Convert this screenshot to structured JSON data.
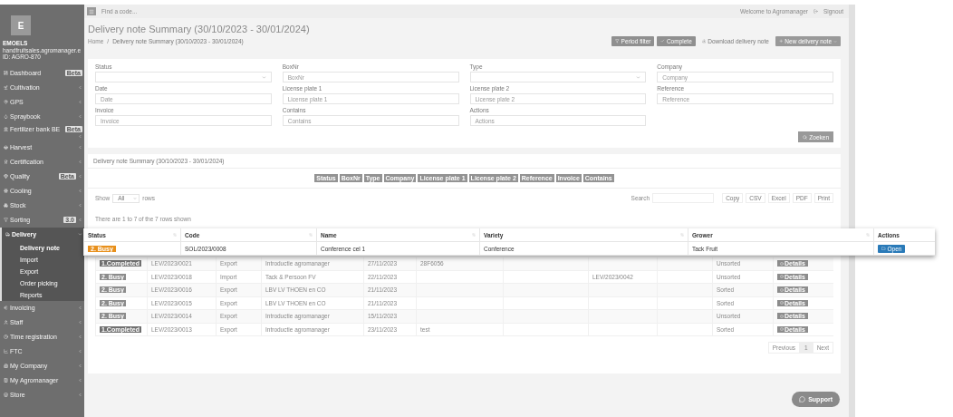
{
  "sidebar": {
    "logo": "E",
    "user": {
      "name": "EMOELS",
      "email": "handfruitsales.agromanager.e",
      "id": "ID: AGRO-870"
    },
    "items": [
      {
        "label": "Dashboard",
        "badge": "Beta",
        "selected": false
      },
      {
        "label": "Cultivation",
        "expanded": false,
        "selected": false
      },
      {
        "label": "GPS",
        "expanded": false,
        "selected": false
      },
      {
        "label": "Spraybook",
        "expanded": false,
        "selected": false
      },
      {
        "label": "Fertilizer bank BE",
        "badge": "Beta",
        "expanded": false,
        "selected": false
      },
      {
        "label": "Harvest",
        "expanded": false,
        "selected": false
      },
      {
        "label": "Certification",
        "expanded": false,
        "selected": false
      },
      {
        "label": "Quality",
        "badge": "Beta",
        "expanded": false,
        "selected": false
      },
      {
        "label": "Cooling",
        "expanded": false,
        "selected": false
      },
      {
        "label": "Stock",
        "expanded": false,
        "selected": false
      },
      {
        "label": "Sorting",
        "badge": "3.0",
        "expanded": false,
        "selected": false
      },
      {
        "label": "Delivery",
        "expanded": true,
        "selected": true,
        "children": [
          {
            "label": "Delivery note",
            "selected": true
          },
          {
            "label": "Import",
            "selected": false
          },
          {
            "label": "Export",
            "selected": false
          },
          {
            "label": "Order picking",
            "selected": false
          },
          {
            "label": "Reports",
            "selected": false
          }
        ]
      },
      {
        "label": "Invoicing",
        "expanded": false,
        "selected": false
      },
      {
        "label": "Staff",
        "expanded": false,
        "selected": false
      },
      {
        "label": "Time registration",
        "expanded": false,
        "selected": false
      },
      {
        "label": "FTC",
        "expanded": false,
        "selected": false
      },
      {
        "label": "My Company",
        "expanded": false,
        "selected": false
      },
      {
        "label": "My Agromanager",
        "expanded": false,
        "selected": false
      },
      {
        "label": "Store",
        "expanded": false,
        "selected": false
      }
    ]
  },
  "topbar": {
    "search_placeholder": "Find a code...",
    "welcome": "Welcome to Agromanager",
    "signout": "Signout"
  },
  "header": {
    "title": "Delivery note Summary (30/10/2023 - 30/01/2024)",
    "breadcrumb_separator": "/",
    "breadcrumb": [
      "Home",
      "Delivery note Summary (30/10/2023 - 30/01/2024)"
    ],
    "buttons": [
      {
        "label": "Period filter",
        "kind": "filled"
      },
      {
        "label": "Complete",
        "kind": "filled"
      },
      {
        "label": "Download delivery note",
        "kind": "link"
      },
      {
        "label": "New delivery note",
        "kind": "dropdown"
      }
    ]
  },
  "filters": {
    "fields": [
      {
        "label": "Status",
        "kind": "select"
      },
      {
        "label": "BoxNr",
        "placeholder": "BoxNr",
        "kind": "text"
      },
      {
        "label": "Type",
        "kind": "select"
      },
      {
        "label": "Company",
        "placeholder": "Company",
        "kind": "text"
      },
      {
        "label": "Date",
        "placeholder": "Date",
        "kind": "text"
      },
      {
        "label": "License plate 1",
        "placeholder": "License plate 1",
        "kind": "text"
      },
      {
        "label": "License plate 2",
        "placeholder": "License plate 2",
        "kind": "text"
      },
      {
        "label": "Reference",
        "placeholder": "Reference",
        "kind": "text"
      },
      {
        "label": "Invoice",
        "placeholder": "Invoice",
        "kind": "text"
      },
      {
        "label": "Contains",
        "placeholder": "Contains",
        "kind": "text"
      },
      {
        "label": "Actions",
        "placeholder": "Actions",
        "kind": "text"
      }
    ],
    "search_button": "Zoeken"
  },
  "summary": {
    "title": "Delivery note Summary (30/10/2023 - 30/01/2024)",
    "column_toggles": [
      "Status",
      "BoxNr",
      "Type",
      "Company",
      "License plate 1",
      "License plate 2",
      "Reference",
      "Invoice",
      "Contains"
    ],
    "show": {
      "label": "Show",
      "value": "All",
      "suffix": "rows"
    },
    "search_label": "Search",
    "export_buttons": [
      "Copy",
      "CSV",
      "Excel",
      "PDF",
      "Print"
    ],
    "info": "There are 1 to 7 of the 7 rows shown",
    "rows": [
      {
        "status": {
          "label": "1.Completed",
          "kind": "completed"
        },
        "cells": [
          "LEV/2023/0021",
          "Export",
          "Introductie agromanager",
          "27/11/2023",
          "28F6056",
          "",
          "",
          "",
          "Unsorted"
        ],
        "action": "Details"
      },
      {
        "status": {
          "label": "2. Busy",
          "kind": "busy"
        },
        "cells": [
          "LEV/2023/0018",
          "Import",
          "Tack & Persoon FV",
          "22/11/2023",
          "",
          "",
          "LEV/2023/0042",
          "",
          "Unsorted"
        ],
        "action": "Details"
      },
      {
        "status": {
          "label": "2. Busy",
          "kind": "busy"
        },
        "cells": [
          "LEV/2023/0016",
          "Export",
          "LBV LV THOEN en CO",
          "21/11/2023",
          "",
          "",
          "",
          "",
          "Sorted"
        ],
        "action": "Details"
      },
      {
        "status": {
          "label": "2. Busy",
          "kind": "busy"
        },
        "cells": [
          "LEV/2023/0015",
          "Export",
          "LBV LV THOEN en CO",
          "21/11/2023",
          "",
          "",
          "",
          "",
          "Sorted"
        ],
        "action": "Details"
      },
      {
        "status": {
          "label": "2. Busy",
          "kind": "busy"
        },
        "cells": [
          "LEV/2023/0014",
          "Export",
          "Introductie agromanager",
          "15/11/2023",
          "",
          "",
          "",
          "",
          "Unsorted"
        ],
        "action": "Details"
      },
      {
        "status": {
          "label": "1.Completed",
          "kind": "completed"
        },
        "cells": [
          "LEV/2023/0013",
          "Export",
          "Introductie agromanager",
          "23/11/2023",
          "test",
          "",
          "",
          "",
          "Sorted"
        ],
        "action": "Details"
      }
    ],
    "pagination": [
      {
        "label": "Previous",
        "selected": false
      },
      {
        "label": "1",
        "selected": true
      },
      {
        "label": "Next",
        "selected": false
      }
    ]
  },
  "support_button": "Support",
  "popup_row": {
    "columns": [
      "Status",
      "Code",
      "Name",
      "Variety",
      "Grower",
      "Actions"
    ],
    "status": {
      "label": "2. Busy",
      "kind": "busy"
    },
    "cells": [
      "SOL/2023/0008",
      "Conference cel 1",
      "Conference",
      "Tack Fruit"
    ],
    "action": "Open"
  }
}
